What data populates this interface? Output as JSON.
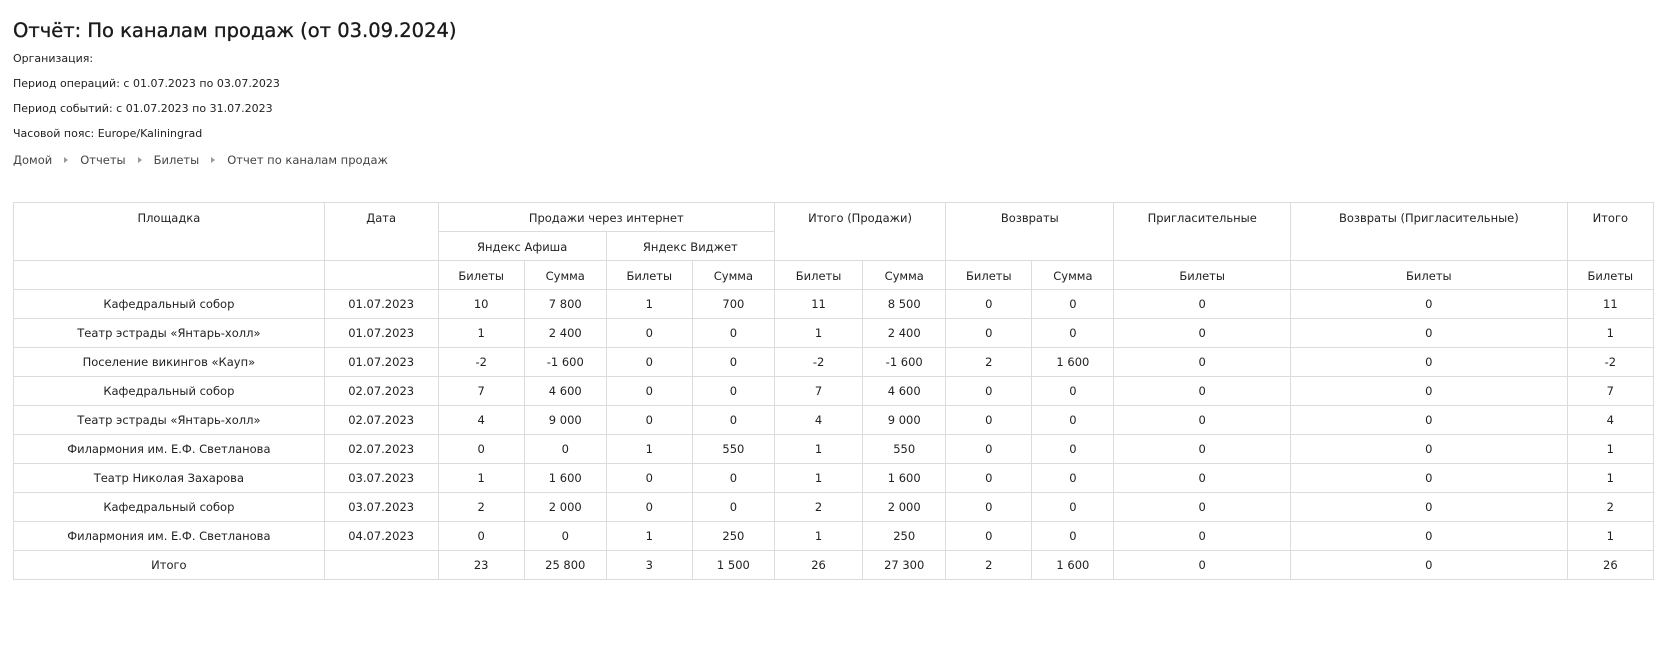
{
  "title": "Отчёт: По каналам продаж (от 03.09.2024)",
  "meta": {
    "organization": "Организация:",
    "ops_period": "Период операций: с 01.07.2023 по 03.07.2023",
    "events_period": "Период событий: с 01.07.2023 по 31.07.2023",
    "timezone": "Часовой пояс: Europe/Kaliningrad"
  },
  "breadcrumb": {
    "home": "Домой",
    "reports": "Отчеты",
    "tickets": "Билеты",
    "current": "Отчет по каналам продаж"
  },
  "table": {
    "headers": {
      "venue": "Площадка",
      "date": "Дата",
      "internet_sales": "Продажи через интернет",
      "total_sales": "Итого (Продажи)",
      "returns": "Возвраты",
      "invitations": "Пригласительные",
      "invitation_returns": "Возвраты (Пригласительные)",
      "total": "Итого",
      "yandex_afisha": "Яндекс Афиша",
      "yandex_widget": "Яндекс Виджет",
      "tickets": "Билеты",
      "sum": "Сумма"
    },
    "rows": [
      [
        "Кафедральный собор",
        "01.07.2023",
        "10",
        "7 800",
        "1",
        "700",
        "11",
        "8 500",
        "0",
        "0",
        "0",
        "0",
        "11"
      ],
      [
        "Театр эстрады «Янтарь-холл»",
        "01.07.2023",
        "1",
        "2 400",
        "0",
        "0",
        "1",
        "2 400",
        "0",
        "0",
        "0",
        "0",
        "1"
      ],
      [
        "Поселение викингов «Кауп»",
        "01.07.2023",
        "-2",
        "-1 600",
        "0",
        "0",
        "-2",
        "-1 600",
        "2",
        "1 600",
        "0",
        "0",
        "-2"
      ],
      [
        "Кафедральный собор",
        "02.07.2023",
        "7",
        "4 600",
        "0",
        "0",
        "7",
        "4 600",
        "0",
        "0",
        "0",
        "0",
        "7"
      ],
      [
        "Театр эстрады «Янтарь-холл»",
        "02.07.2023",
        "4",
        "9 000",
        "0",
        "0",
        "4",
        "9 000",
        "0",
        "0",
        "0",
        "0",
        "4"
      ],
      [
        "Филармония им. Е.Ф. Светланова",
        "02.07.2023",
        "0",
        "0",
        "1",
        "550",
        "1",
        "550",
        "0",
        "0",
        "0",
        "0",
        "1"
      ],
      [
        "Театр Николая Захарова",
        "03.07.2023",
        "1",
        "1 600",
        "0",
        "0",
        "1",
        "1 600",
        "0",
        "0",
        "0",
        "0",
        "1"
      ],
      [
        "Кафедральный собор",
        "03.07.2023",
        "2",
        "2 000",
        "0",
        "0",
        "2",
        "2 000",
        "0",
        "0",
        "0",
        "0",
        "2"
      ],
      [
        "Филармония им. Е.Ф. Светланова",
        "04.07.2023",
        "0",
        "0",
        "1",
        "250",
        "1",
        "250",
        "0",
        "0",
        "0",
        "0",
        "1"
      ]
    ],
    "totals": [
      "Итого",
      "",
      "23",
      "25 800",
      "3",
      "1 500",
      "26",
      "27 300",
      "2",
      "1 600",
      "0",
      "0",
      "26"
    ]
  }
}
